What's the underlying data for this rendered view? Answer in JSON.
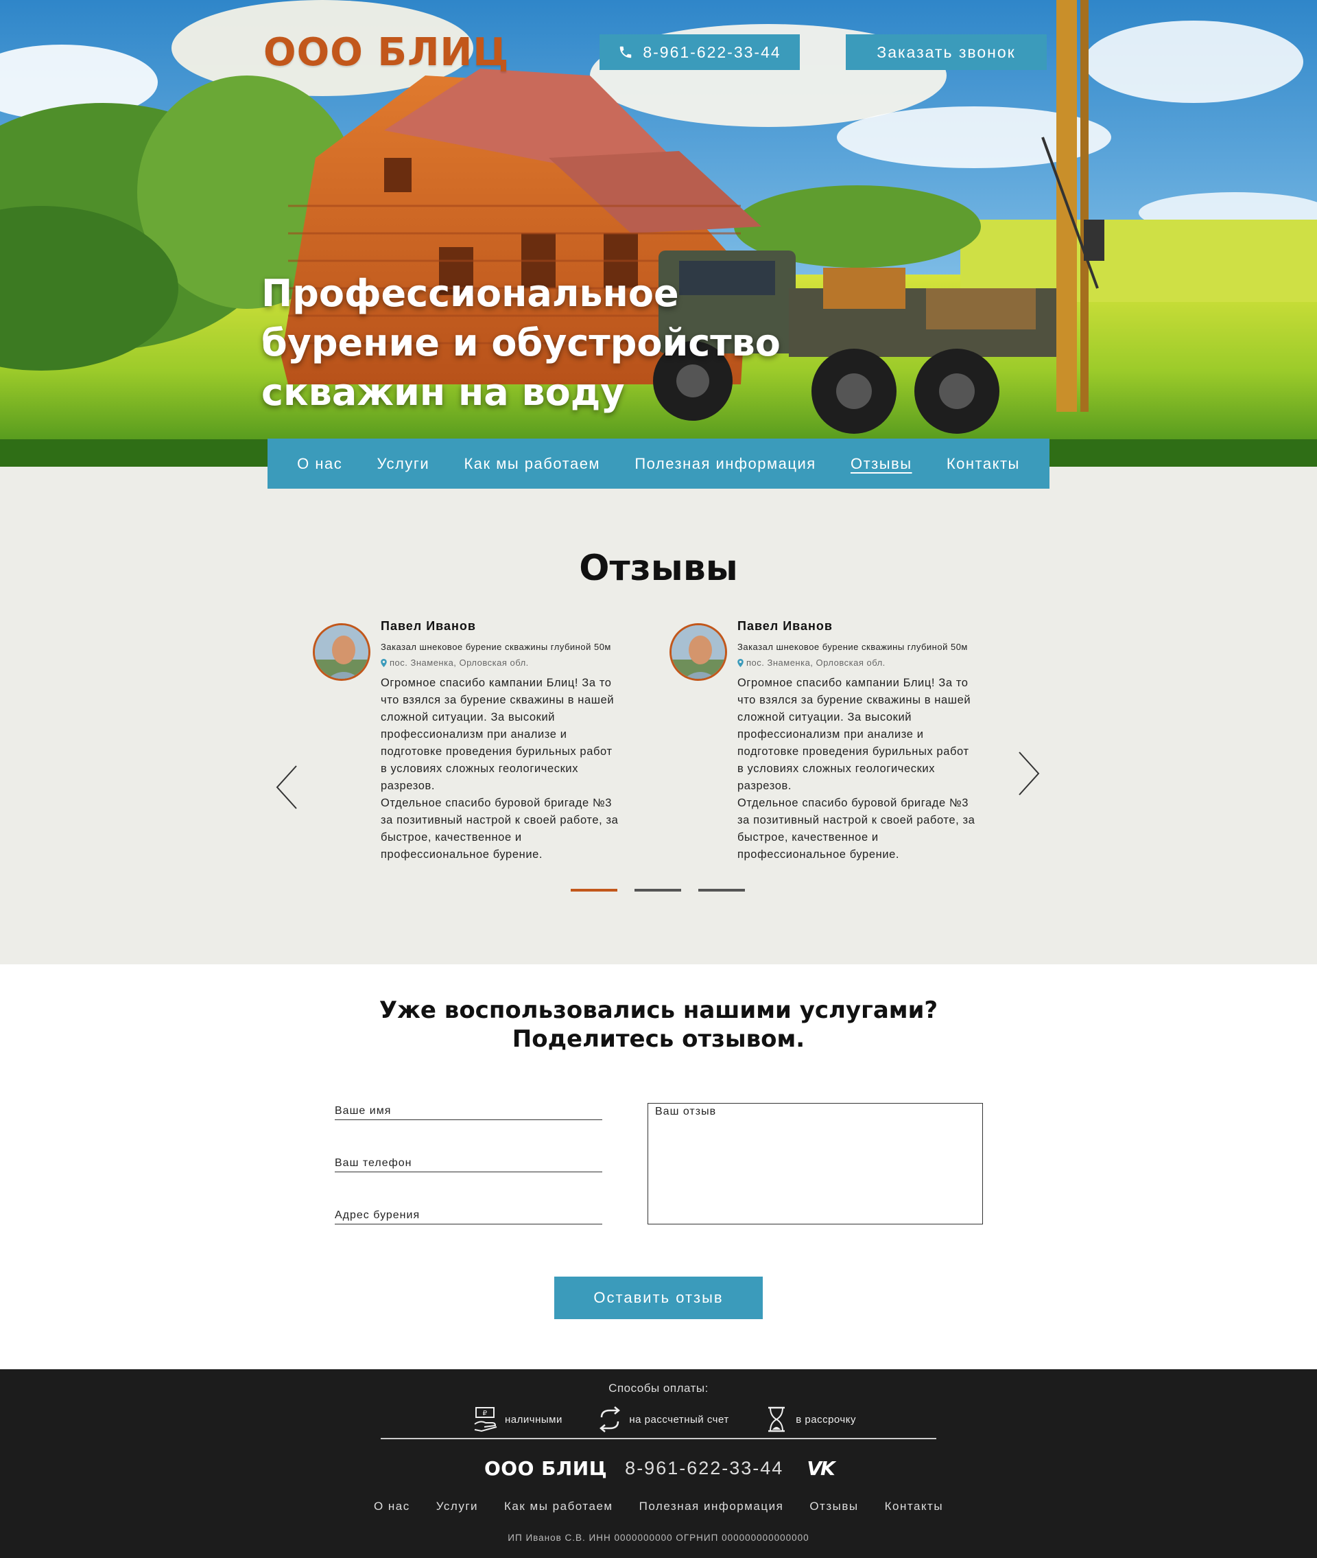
{
  "header": {
    "logo": "ООО БЛИЦ",
    "phone_button": "8-961-622-33-44",
    "callback_button": "Заказать звонок"
  },
  "hero": {
    "title_lines": [
      "Профессиональное",
      "бурение и обустройство",
      "скважин на воду"
    ]
  },
  "nav": {
    "items": [
      "О нас",
      "Услуги",
      "Как мы работаем",
      "Полезная информация",
      "Отзывы",
      "Контакты"
    ],
    "active": "Отзывы"
  },
  "reviews": {
    "title": "Отзывы",
    "cards": [
      {
        "name": "Павел Иванов",
        "subtitle": "Заказал шнековое бурение скважины глубиной 50м",
        "location": "пос. Знаменка, Орловская обл.",
        "text": "Огромное спасибо кампании Блиц! За то\nчто взялся за бурение скважины в  нашей\nсложной ситуации. За высокий\nпрофессионализм при анализе и\nподготовке проведения бурильных работ\nв условиях сложных геологических\nразрезов.\nОтдельное спасибо буровой бригаде №3\nза позитивный настрой к своей работе, за\nбыстрое, качественное и\nпрофессиональное бурение."
      },
      {
        "name": "Павел Иванов",
        "subtitle": "Заказал шнековое бурение скважины глубиной 50м",
        "location": "пос. Знаменка, Орловская обл.",
        "text": "Огромное спасибо кампании Блиц! За то\nчто взялся за бурение скважины в  нашей\nсложной ситуации. За высокий\nпрофессионализм при анализе и\nподготовке проведения бурильных работ\nв условиях сложных геологических\nразрезов.\nОтдельное спасибо буровой бригаде №3\nза позитивный настрой к своей работе, за\nбыстрое, качественное и\nпрофессиональное бурение."
      }
    ],
    "slider_dots": 3,
    "active_dot": 0
  },
  "form": {
    "title_line1": "Уже воспользовались нашими услугами?",
    "title_line2": "Поделитесь отзывом.",
    "name_placeholder": "Ваше имя",
    "phone_placeholder": "Ваш телефон",
    "address_placeholder": "Адрес бурения",
    "review_placeholder": "Ваш отзыв",
    "submit": "Оставить отзыв"
  },
  "footer": {
    "payment_title": "Способы оплаты:",
    "payment_methods": [
      {
        "label": "наличными",
        "icon": "cash-hand-icon"
      },
      {
        "label": "на рассчетный счет",
        "icon": "transfer-arrows-icon"
      },
      {
        "label": "в рассрочку",
        "icon": "hourglass-icon"
      }
    ],
    "logo": "ООО БЛИЦ",
    "phone": "8-961-622-33-44",
    "social": "vk-icon",
    "nav": [
      "О нас",
      "Услуги",
      "Как мы работаем",
      "Полезная информация",
      "Отзывы",
      "Контакты"
    ],
    "legal": "ИП Иванов С.В. ИНН 0000000000 ОГРНИП 000000000000000"
  },
  "colors": {
    "accent": "#3b9bbb",
    "brand": "#c2571b",
    "reviews_bg": "#edede8",
    "footer_bg": "#1c1c1c"
  }
}
